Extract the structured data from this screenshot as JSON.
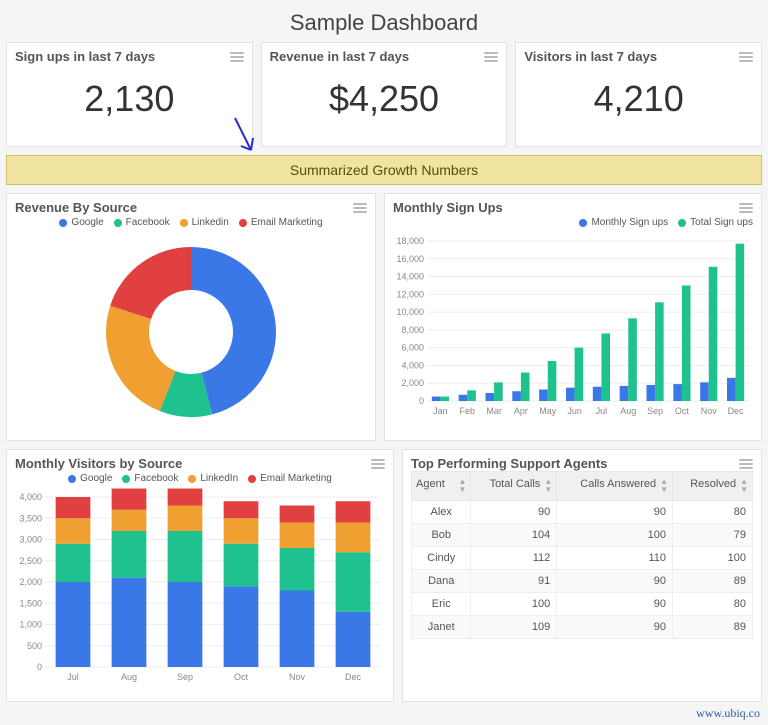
{
  "title": "Sample Dashboard",
  "kpis": [
    {
      "label": "Sign ups in last 7 days",
      "value": "2,130"
    },
    {
      "label": "Revenue in last 7 days",
      "value": "$4,250"
    },
    {
      "label": "Visitors in last 7 days",
      "value": "4,210"
    }
  ],
  "banner": "Summarized Growth Numbers",
  "panels": {
    "revenue_by_source": {
      "title": "Revenue By Source"
    },
    "monthly_sign_ups": {
      "title": "Monthly Sign Ups"
    },
    "monthly_visitors": {
      "title": "Monthly Visitors by Source"
    },
    "top_agents": {
      "title": "Top Performing Support Agents"
    }
  },
  "colors": {
    "google": "#3b78e7",
    "facebook": "#1fc28f",
    "linkedin": "#f0a030",
    "email": "#e04040",
    "monthly": "#3b78e7",
    "total": "#1fc28f"
  },
  "legends": {
    "pie": [
      "Google",
      "Facebook",
      "Linkedin",
      "Email Marketing"
    ],
    "signups": [
      "Monthly Sign ups",
      "Total Sign ups"
    ],
    "visitors": [
      "Google",
      "Facebook",
      "LinkedIn",
      "Email Marketing"
    ]
  },
  "table": {
    "headers": [
      "Agent",
      "Total Calls",
      "Calls Answered",
      "Resolved"
    ],
    "rows": [
      [
        "Alex",
        "90",
        "90",
        "80"
      ],
      [
        "Bob",
        "104",
        "100",
        "79"
      ],
      [
        "Cindy",
        "112",
        "110",
        "100"
      ],
      [
        "Dana",
        "91",
        "90",
        "89"
      ],
      [
        "Eric",
        "100",
        "90",
        "80"
      ],
      [
        "Janet",
        "109",
        "90",
        "89"
      ]
    ]
  },
  "footer": "www.ubiq.co",
  "chart_data": [
    {
      "type": "pie",
      "title": "Revenue By Source",
      "series": [
        {
          "name": "Google",
          "value": 46
        },
        {
          "name": "Facebook",
          "value": 10
        },
        {
          "name": "Linkedin",
          "value": 24
        },
        {
          "name": "Email Marketing",
          "value": 20
        }
      ]
    },
    {
      "type": "bar",
      "title": "Monthly Sign Ups",
      "categories": [
        "Jan",
        "Feb",
        "Mar",
        "Apr",
        "May",
        "Jun",
        "Jul",
        "Aug",
        "Sep",
        "Oct",
        "Nov",
        "Dec"
      ],
      "series": [
        {
          "name": "Monthly Sign ups",
          "values": [
            500,
            700,
            900,
            1100,
            1300,
            1500,
            1600,
            1700,
            1800,
            1900,
            2100,
            2600
          ]
        },
        {
          "name": "Total Sign ups",
          "values": [
            500,
            1200,
            2100,
            3200,
            4500,
            6000,
            7600,
            9300,
            11100,
            13000,
            15100,
            17700
          ]
        }
      ],
      "ylabel": "",
      "ylim": [
        0,
        18000
      ],
      "ytick": 2000
    },
    {
      "type": "bar-stacked",
      "title": "Monthly Visitors by Source",
      "categories": [
        "Jul",
        "Aug",
        "Sep",
        "Oct",
        "Nov",
        "Dec"
      ],
      "series": [
        {
          "name": "Google",
          "values": [
            2000,
            2100,
            2000,
            1900,
            1800,
            1300
          ]
        },
        {
          "name": "Facebook",
          "values": [
            900,
            1100,
            1200,
            1000,
            1000,
            1400
          ]
        },
        {
          "name": "LinkedIn",
          "values": [
            600,
            500,
            600,
            600,
            600,
            700
          ]
        },
        {
          "name": "Email Marketing",
          "values": [
            500,
            500,
            400,
            400,
            400,
            500
          ]
        }
      ],
      "ylim": [
        0,
        4000
      ],
      "ytick": 500
    },
    {
      "type": "table",
      "title": "Top Performing Support Agents",
      "columns": [
        "Agent",
        "Total Calls",
        "Calls Answered",
        "Resolved"
      ],
      "rows": [
        [
          "Alex",
          90,
          90,
          80
        ],
        [
          "Bob",
          104,
          100,
          79
        ],
        [
          "Cindy",
          112,
          110,
          100
        ],
        [
          "Dana",
          91,
          90,
          89
        ],
        [
          "Eric",
          100,
          90,
          80
        ],
        [
          "Janet",
          109,
          90,
          89
        ]
      ]
    }
  ]
}
